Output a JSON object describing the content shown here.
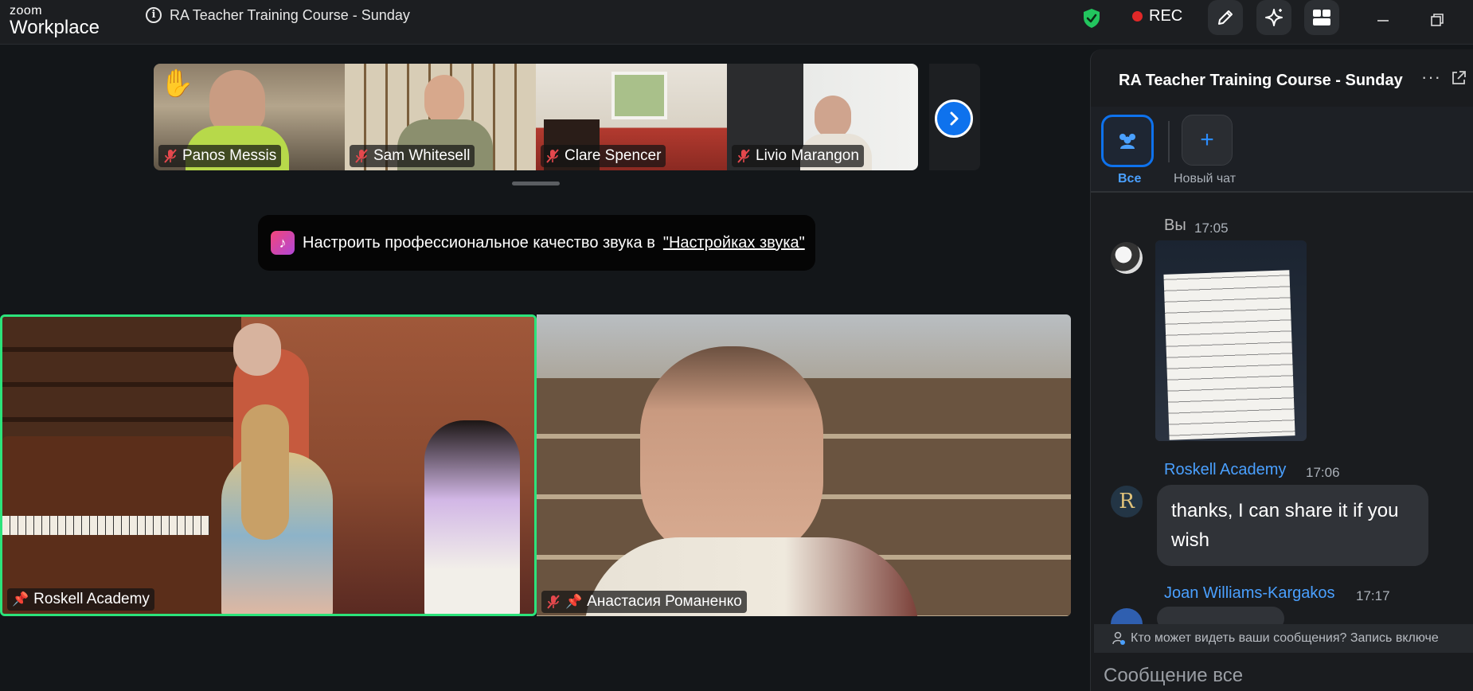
{
  "app": {
    "logo_top": "zoom",
    "logo_bottom": "Workplace"
  },
  "titlebar": {
    "meeting_title": "RA Teacher Training Course - Sunday",
    "rec_label": "REC"
  },
  "gallery": {
    "participants": [
      {
        "name": "Panos Messis",
        "muted": true,
        "hand_raised": true
      },
      {
        "name": "Sam Whitesell",
        "muted": true
      },
      {
        "name": "Clare Spencer",
        "muted": true
      },
      {
        "name": "Livio Marangon",
        "muted": true
      }
    ]
  },
  "banner": {
    "text": "Настроить профессиональное качество звука в",
    "link": "\"Настройках звука\""
  },
  "main_tiles": [
    {
      "name": "Roskell Academy",
      "pinned": true,
      "active_speaker": true
    },
    {
      "name": "Анастасия Романенко",
      "muted": true,
      "pinned": true
    }
  ],
  "chat": {
    "title": "RA Teacher Training Course - Sunday",
    "tab_all": "Все",
    "tab_new": "Новый чат",
    "messages": [
      {
        "sender": "Вы",
        "time": "17:05",
        "type": "image"
      },
      {
        "sender": "Roskell Academy",
        "time": "17:06",
        "text": "thanks, I can share it if you wish"
      },
      {
        "sender": "Joan Williams-Kargakos",
        "time": "17:17"
      }
    ],
    "privacy_text": "Кто может видеть ваши сообщения? Запись включе",
    "compose_placeholder": "Сообщение все"
  },
  "colors": {
    "accent": "#0e72ed",
    "speaker_border": "#2ce37b",
    "rec": "#e02828",
    "shield": "#22c55e"
  }
}
